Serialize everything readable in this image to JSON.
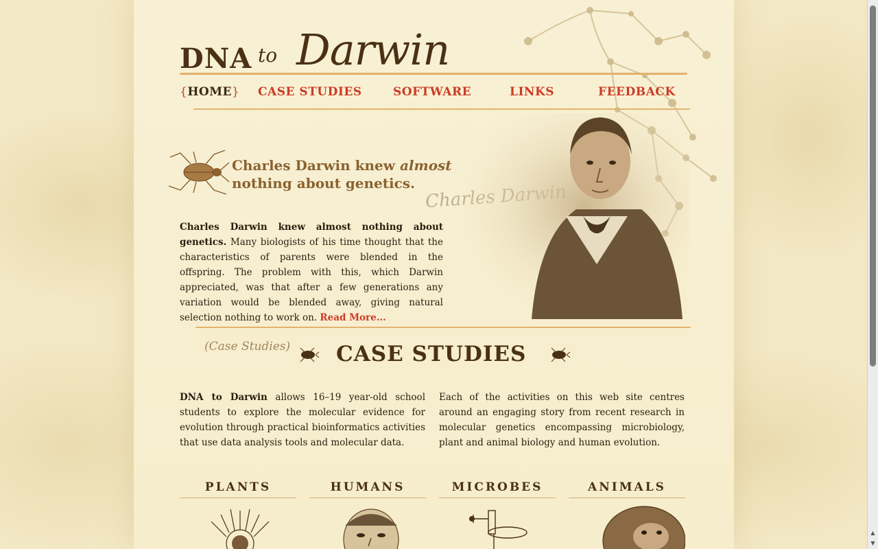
{
  "logo": {
    "dna": "DNA",
    "to": "to",
    "darwin": "Darwin"
  },
  "nav": {
    "brace_open": "{",
    "brace_close": "}",
    "items": [
      {
        "label": "HOME",
        "active": true
      },
      {
        "label": "CASE STUDIES",
        "active": false
      },
      {
        "label": "SOFTWARE",
        "active": false
      },
      {
        "label": "LINKS",
        "active": false
      },
      {
        "label": "FEEDBACK",
        "active": false
      }
    ]
  },
  "hero": {
    "headline_part1": "Charles Darwin knew ",
    "headline_em": "almost",
    "headline_part2": " nothing about genetics.",
    "signature": "Charles Darwin",
    "intro_bold": "Charles Darwin knew almost nothing about genetics.",
    "intro_text": " Many biologists of his time thought that the characteristics of parents were blended in the offspring. The problem with this, which Darwin appreciated, was that after a few generations any variation would be blended away, giving natural selection nothing to work on. ",
    "read_more": "Read More..."
  },
  "case_studies": {
    "script_label": "(Case Studies)",
    "title": "CASE STUDIES",
    "para_left_bold": "DNA to Darwin",
    "para_left_text": " allows 16–19 year-old school students to explore the molecular evidence for evolution through practical bioinformatics activities that use data analysis tools and molecular data.",
    "para_right": "Each of the activities on this web site centres around an engaging story from recent research in molecular genetics encompassing microbiology, plant and animal biology and human evolution.",
    "categories": [
      "PLANTS",
      "HUMANS",
      "MICROBES",
      "ANIMALS"
    ]
  },
  "colors": {
    "background": "#f3e8c4",
    "accent_red": "#cc3b25",
    "brown_dark": "#4a3114",
    "rule_gold": "#e2b26e"
  }
}
